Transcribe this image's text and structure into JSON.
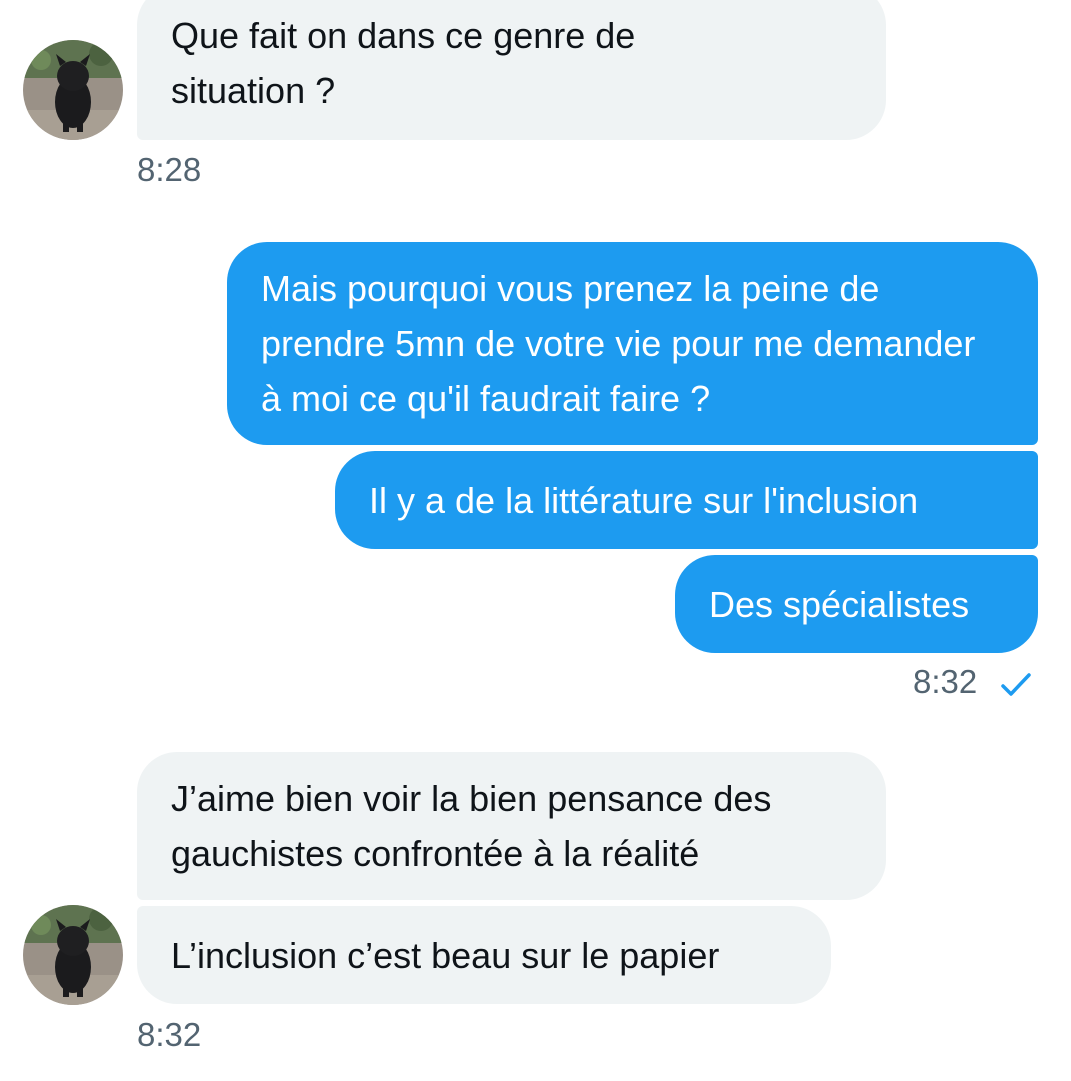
{
  "incoming_group_1": {
    "messages": [
      "Que fait on dans ce genre de situation ?"
    ],
    "time": "8:28"
  },
  "outgoing_group": {
    "messages": [
      "Mais pourquoi vous prenez la peine de prendre 5mn de votre vie pour me demander à moi ce qu'il faudrait faire ?",
      "Il y a de la littérature sur l'inclusion",
      "Des spécialistes"
    ],
    "time": "8:32",
    "status_icon": "checkmark-icon"
  },
  "incoming_group_2": {
    "messages": [
      "J’aime bien voir la bien pensance des gauchistes confrontée à la réalité",
      "L’inclusion c’est beau sur le papier"
    ],
    "time": "8:32"
  },
  "colors": {
    "sent_bubble": "#1d9bf0",
    "received_bubble": "#eff3f4",
    "timestamp": "#536471",
    "read_check": "#1d9bf0"
  }
}
